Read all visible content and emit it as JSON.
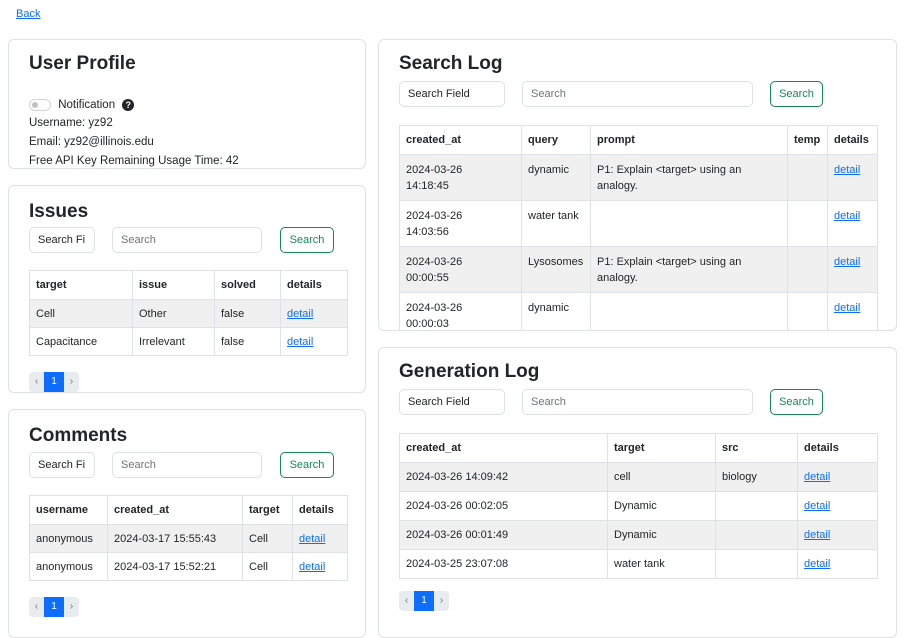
{
  "nav": {
    "back": "Back"
  },
  "profile": {
    "title": "User Profile",
    "notification_label": "Notification",
    "help_glyph": "?",
    "username": "Username: yz92",
    "email": "Email: yz92@illinois.edu",
    "api_usage": "Free API Key Remaining Usage Time: 42"
  },
  "issues": {
    "title": "Issues",
    "field_select": "Search Fi",
    "search_placeholder": "Search",
    "search_button": "Search",
    "headers": [
      "target",
      "issue",
      "solved",
      "details"
    ],
    "rows": [
      [
        "Cell",
        "Other",
        "false",
        "detail"
      ],
      [
        "Capacitance",
        "Irrelevant",
        "false",
        "detail"
      ]
    ],
    "pager": {
      "prev": "‹",
      "page": "1",
      "next": "›"
    }
  },
  "comments": {
    "title": "Comments",
    "field_select": "Search Fi",
    "search_placeholder": "Search",
    "search_button": "Search",
    "headers": [
      "username",
      "created_at",
      "target",
      "details"
    ],
    "rows": [
      [
        "anonymous",
        "2024-03-17 15:55:43",
        "Cell",
        "detail"
      ],
      [
        "anonymous",
        "2024-03-17 15:52:21",
        "Cell",
        "detail"
      ]
    ],
    "pager": {
      "prev": "‹",
      "page": "1",
      "next": "›"
    }
  },
  "search_log": {
    "title": "Search Log",
    "field_select": "Search Field",
    "search_placeholder": "Search",
    "search_button": "Search",
    "headers": [
      "created_at",
      "query",
      "prompt",
      "temp",
      "details"
    ],
    "rows": [
      {
        "date": "2024-03-26",
        "time": "14:18:45",
        "query": "dynamic",
        "prompt1": "P1: Explain <target> using an",
        "prompt2": "analogy.",
        "temp": "",
        "details": "detail"
      },
      {
        "date": "2024-03-26",
        "time": "14:03:56",
        "query": "water tank",
        "prompt1": "",
        "prompt2": "",
        "temp": "",
        "details": "detail"
      },
      {
        "date": "2024-03-26",
        "time": "00:00:55",
        "query": "Lysosomes",
        "prompt1": "P1: Explain <target> using an",
        "prompt2": "analogy.",
        "temp": "",
        "details": "detail"
      },
      {
        "date": "2024-03-26",
        "time": "00:00:03",
        "query": "dynamic",
        "prompt1": "",
        "prompt2": "",
        "temp": "",
        "details": "detail"
      }
    ]
  },
  "generation_log": {
    "title": "Generation Log",
    "field_select": "Search Field",
    "search_placeholder": "Search",
    "search_button": "Search",
    "headers": [
      "created_at",
      "target",
      "src",
      "details"
    ],
    "rows": [
      [
        "2024-03-26 14:09:42",
        "cell",
        "biology",
        "detail"
      ],
      [
        "2024-03-26 00:02:05",
        "Dynamic",
        "",
        "detail"
      ],
      [
        "2024-03-26 00:01:49",
        "Dynamic",
        "",
        "detail"
      ],
      [
        "2024-03-25 23:07:08",
        "water tank",
        "",
        "detail"
      ]
    ],
    "pager": {
      "prev": "‹",
      "page": "1",
      "next": "›"
    }
  }
}
